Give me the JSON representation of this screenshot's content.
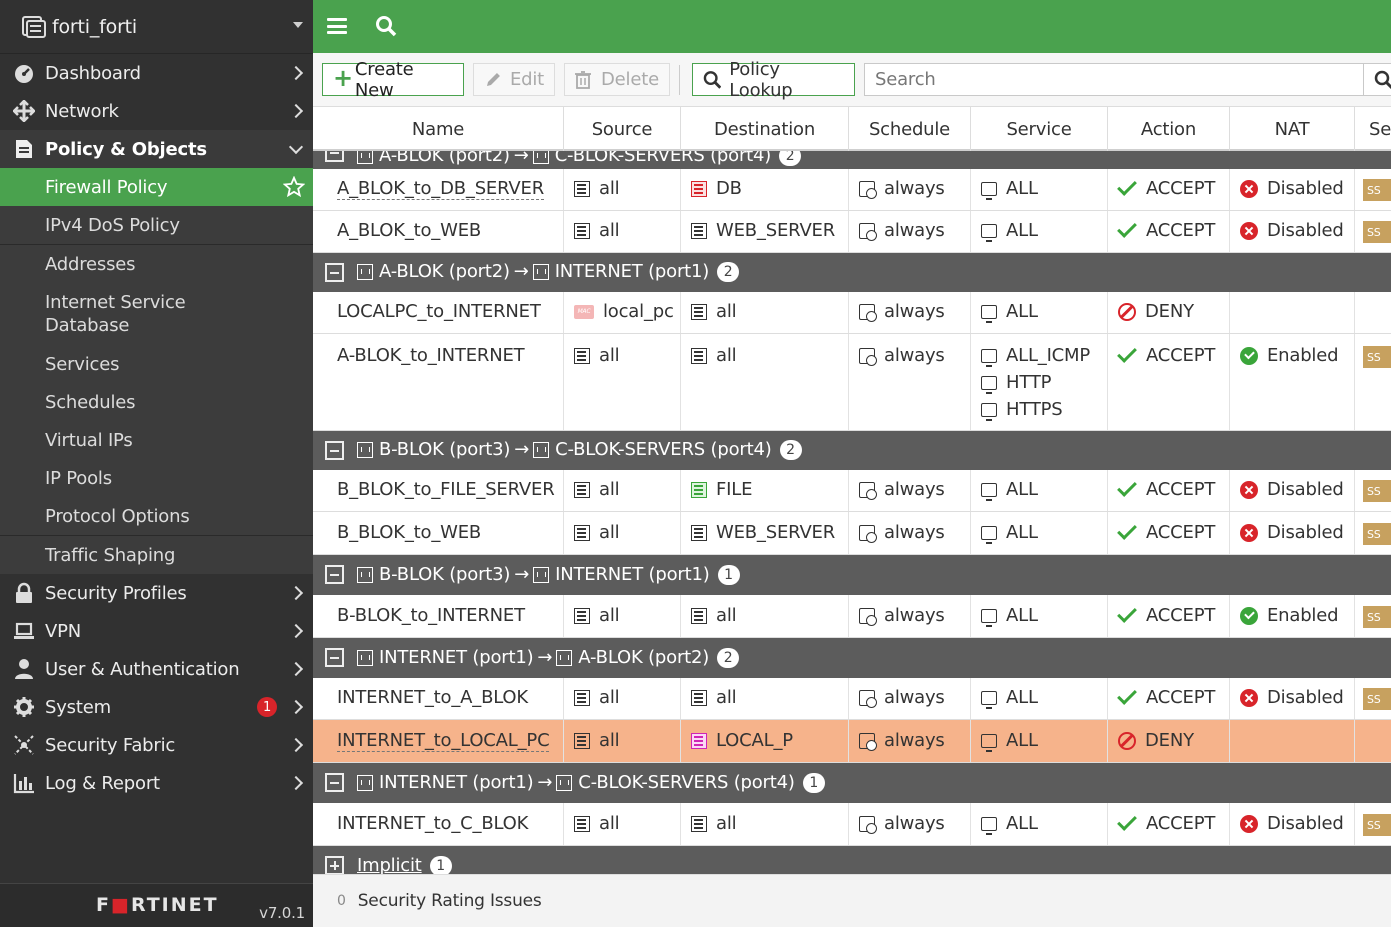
{
  "device": {
    "name": "forti_forti"
  },
  "sidebar": {
    "items": [
      {
        "label": "Dashboard",
        "icon": "dashboard-icon"
      },
      {
        "label": "Network",
        "icon": "network-icon"
      },
      {
        "label": "Policy & Objects",
        "icon": "policy-icon"
      },
      {
        "label": "Security Profiles",
        "icon": "lock-icon"
      },
      {
        "label": "VPN",
        "icon": "laptop-icon"
      },
      {
        "label": "User & Authentication",
        "icon": "user-icon"
      },
      {
        "label": "System",
        "icon": "gear-icon",
        "badge": "1"
      },
      {
        "label": "Security Fabric",
        "icon": "fabric-icon"
      },
      {
        "label": "Log & Report",
        "icon": "chart-icon"
      }
    ],
    "subitems": [
      "Firewall Policy",
      "IPv4 DoS Policy",
      "Addresses",
      "Internet Service Database",
      "Services",
      "Schedules",
      "Virtual IPs",
      "IP Pools",
      "Protocol Options",
      "Traffic Shaping"
    ],
    "footer": {
      "logo": "F:RTINET",
      "version": "v7.0.1"
    }
  },
  "toolbar": {
    "create": "Create New",
    "edit": "Edit",
    "delete": "Delete",
    "lookup": "Policy Lookup",
    "search_placeholder": "Search"
  },
  "table": {
    "headers": [
      "Name",
      "Source",
      "Destination",
      "Schedule",
      "Service",
      "Action",
      "NAT",
      "Sec"
    ],
    "groups": [
      {
        "label": "A-BLOK (port2) → C-BLOK-SERVERS (port4)",
        "src": "A-BLOK (port2)",
        "dst": "C-BLOK-SERVERS (port4)",
        "count": "2"
      },
      {
        "src": "A-BLOK (port2)",
        "dst": "INTERNET (port1)",
        "count": "2"
      },
      {
        "src": "B-BLOK (port3)",
        "dst": "C-BLOK-SERVERS (port4)",
        "count": "2"
      },
      {
        "src": "B-BLOK (port3)",
        "dst": "INTERNET (port1)",
        "count": "1"
      },
      {
        "src": "INTERNET (port1)",
        "dst": "A-BLOK (port2)",
        "count": "2"
      },
      {
        "src": "INTERNET (port1)",
        "dst": "C-BLOK-SERVERS (port4)",
        "count": "1"
      },
      {
        "label": "Implicit",
        "count": "1"
      }
    ],
    "rows": [
      {
        "name": "A_BLOK_to_DB_SERVER",
        "source": "all",
        "destination": "DB",
        "schedule": "always",
        "service": "ALL",
        "action": "ACCEPT",
        "nat": "Disabled"
      },
      {
        "name": "A_BLOK_to_WEB",
        "source": "all",
        "destination": "WEB_SERVER",
        "schedule": "always",
        "service": "ALL",
        "action": "ACCEPT",
        "nat": "Disabled"
      },
      {
        "name": "LOCALPC_to_INTERNET",
        "source": "local_pc",
        "destination": "all",
        "schedule": "always",
        "service": "ALL",
        "action": "DENY",
        "nat": ""
      },
      {
        "name": "A-BLOK_to_INTERNET",
        "source": "all",
        "destination": "all",
        "schedule": "always",
        "services": [
          "ALL_ICMP",
          "HTTP",
          "HTTPS"
        ],
        "action": "ACCEPT",
        "nat": "Enabled"
      },
      {
        "name": "B_BLOK_to_FILE_SERVER",
        "source": "all",
        "destination": "FILE",
        "schedule": "always",
        "service": "ALL",
        "action": "ACCEPT",
        "nat": "Disabled"
      },
      {
        "name": "B_BLOK_to_WEB",
        "source": "all",
        "destination": "WEB_SERVER",
        "schedule": "always",
        "service": "ALL",
        "action": "ACCEPT",
        "nat": "Disabled"
      },
      {
        "name": "B-BLOK_to_INTERNET",
        "source": "all",
        "destination": "all",
        "schedule": "always",
        "service": "ALL",
        "action": "ACCEPT",
        "nat": "Enabled"
      },
      {
        "name": "INTERNET_to_A_BLOK",
        "source": "all",
        "destination": "all",
        "schedule": "always",
        "service": "ALL",
        "action": "ACCEPT",
        "nat": "Disabled"
      },
      {
        "name": "INTERNET_to_LOCAL_PC",
        "source": "all",
        "destination": "LOCAL_P",
        "schedule": "always",
        "service": "ALL",
        "action": "DENY",
        "nat": ""
      },
      {
        "name": "INTERNET_to_C_BLOK",
        "source": "all",
        "destination": "all",
        "schedule": "always",
        "service": "ALL",
        "action": "ACCEPT",
        "nat": "Disabled"
      }
    ],
    "sec_badge": "SS"
  },
  "status": {
    "count": "0",
    "label": "Security Rating Issues"
  },
  "colors": {
    "accent": "#4aa24e",
    "sidebar_bg": "#313131",
    "group_bg": "#5c5c5c",
    "highlight_row": "#f6b38b",
    "deny": "#d8242a"
  }
}
